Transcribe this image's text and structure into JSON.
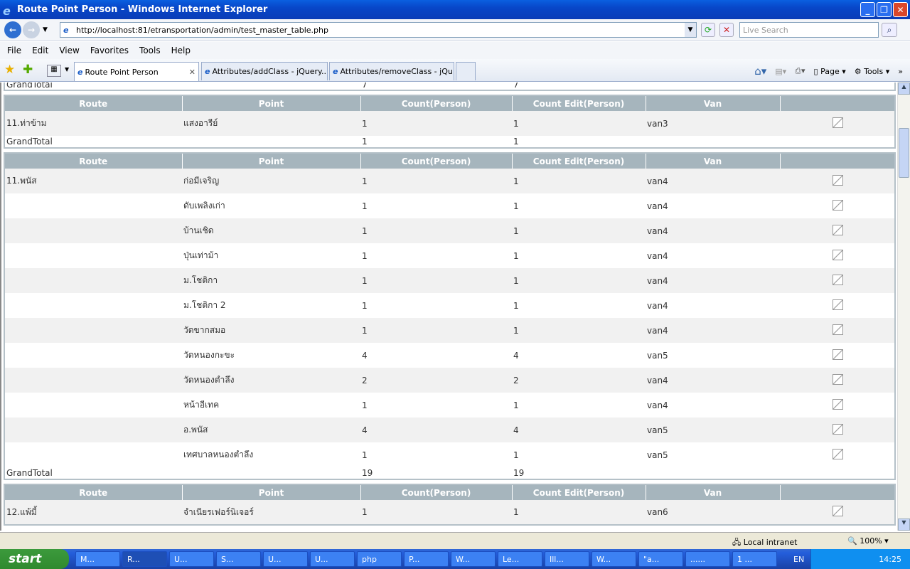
{
  "window": {
    "title": "Route Point Person - Windows Internet Explorer"
  },
  "address": {
    "url": "http://localhost:81/etransportation/admin/test_master_table.php",
    "search_placeholder": "Live Search"
  },
  "menu": [
    "File",
    "Edit",
    "View",
    "Favorites",
    "Tools",
    "Help"
  ],
  "tabs": [
    {
      "label": "Route Point Person"
    },
    {
      "label": "Attributes/addClass - jQuery..."
    },
    {
      "label": "Attributes/removeClass - jQu..."
    }
  ],
  "toolbar": {
    "page": "Page",
    "tools": "Tools"
  },
  "columns": [
    "Route",
    "Point",
    "Count(Person)",
    "Count Edit(Person)",
    "Van"
  ],
  "grand_total_label": "GrandTotal",
  "top_partial_total": {
    "count": "7",
    "count_edit": "7"
  },
  "sections": [
    {
      "total": {
        "count": "1",
        "count_edit": "1"
      },
      "rows": [
        {
          "route": "11.ท่าข้าม",
          "point": "แสงอารีย์",
          "count": "1",
          "count_edit": "1",
          "van": "van3"
        }
      ]
    },
    {
      "total": {
        "count": "19",
        "count_edit": "19"
      },
      "rows": [
        {
          "route": "11.พนัส",
          "point": "ก่อมีเจริญ",
          "count": "1",
          "count_edit": "1",
          "van": "van4"
        },
        {
          "route": "",
          "point": "ดับเพลิงเก่า",
          "count": "1",
          "count_edit": "1",
          "van": "van4"
        },
        {
          "route": "",
          "point": "บ้านเชิด",
          "count": "1",
          "count_edit": "1",
          "van": "van4"
        },
        {
          "route": "",
          "point": "ปุ่นเท่าม้า",
          "count": "1",
          "count_edit": "1",
          "van": "van4"
        },
        {
          "route": "",
          "point": "ม.โชติกา",
          "count": "1",
          "count_edit": "1",
          "van": "van4"
        },
        {
          "route": "",
          "point": "ม.โชติกา 2",
          "count": "1",
          "count_edit": "1",
          "van": "van4"
        },
        {
          "route": "",
          "point": "วัดขากสมอ",
          "count": "1",
          "count_edit": "1",
          "van": "van4"
        },
        {
          "route": "",
          "point": "วัดหนองกะขะ",
          "count": "4",
          "count_edit": "4",
          "van": "van5"
        },
        {
          "route": "",
          "point": "วัดหนองตำลึง",
          "count": "2",
          "count_edit": "2",
          "van": "van4"
        },
        {
          "route": "",
          "point": "หน้าอีเทค",
          "count": "1",
          "count_edit": "1",
          "van": "van4"
        },
        {
          "route": "",
          "point": "อ.พนัส",
          "count": "4",
          "count_edit": "4",
          "van": "van5"
        },
        {
          "route": "",
          "point": "เทศบาลหนองตำลึง",
          "count": "1",
          "count_edit": "1",
          "van": "van5"
        }
      ]
    },
    {
      "total": null,
      "rows": [
        {
          "route": "12.แพ้มี้",
          "point": "จำเนียรเฟอร์นิเจอร์",
          "count": "1",
          "count_edit": "1",
          "van": "van6"
        }
      ]
    }
  ],
  "status": {
    "zone": "Local intranet",
    "zoom": "100%"
  },
  "taskbar": {
    "start": "start",
    "items": [
      "M...",
      "R...",
      "U...",
      "S...",
      "U...",
      "U...",
      "php",
      "P...",
      "W...",
      "Le...",
      "Ill...",
      "W...",
      "\"a...",
      "......",
      "1 ..."
    ],
    "lang": "EN",
    "clock": "14:25"
  }
}
